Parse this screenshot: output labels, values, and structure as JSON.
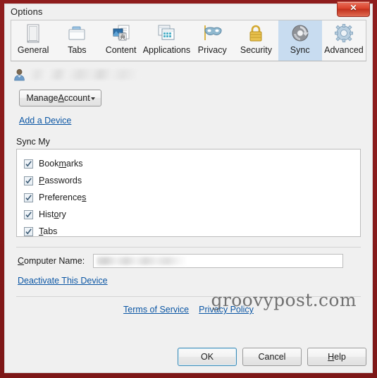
{
  "window": {
    "title": "Options",
    "close_glyph": "✕",
    "close_label": "Close",
    "frame_color": "#8a1b1b"
  },
  "tabs": [
    {
      "label": "General",
      "icon": "general-icon",
      "selected": false
    },
    {
      "label": "Tabs",
      "icon": "tabs-icon",
      "selected": false
    },
    {
      "label": "Content",
      "icon": "content-icon",
      "selected": false
    },
    {
      "label": "Applications",
      "icon": "applications-icon",
      "selected": false
    },
    {
      "label": "Privacy",
      "icon": "privacy-mask-icon",
      "selected": false
    },
    {
      "label": "Security",
      "icon": "security-lock-icon",
      "selected": false
    },
    {
      "label": "Sync",
      "icon": "sync-icon",
      "selected": true
    },
    {
      "label": "Advanced",
      "icon": "advanced-gear-icon",
      "selected": false
    }
  ],
  "sync_panel": {
    "account": {
      "avatar_icon": "user-avatar-icon",
      "name_value": "",
      "name_redacted": true
    },
    "manage_account": {
      "label_before": "Manage ",
      "label_accel": "A",
      "label_after": "ccount",
      "full_label": "Manage Account",
      "has_dropdown": true
    },
    "add_device_link": "Add a Device",
    "sync_my_label": "Sync My",
    "sync_items": [
      {
        "label_before": "Book",
        "accel": "m",
        "label_after": "arks",
        "full_label": "Bookmarks",
        "checked": true
      },
      {
        "label_before": "",
        "accel": "P",
        "label_after": "asswords",
        "full_label": "Passwords",
        "checked": true
      },
      {
        "label_before": "Preference",
        "accel": "s",
        "label_after": "",
        "full_label": "Preferences",
        "checked": true
      },
      {
        "label_before": "Hist",
        "accel": "o",
        "label_after": "ry",
        "full_label": "History",
        "checked": true
      },
      {
        "label_before": "",
        "accel": "T",
        "label_after": "abs",
        "full_label": "Tabs",
        "checked": true
      }
    ],
    "computer_name": {
      "label_accel": "C",
      "label_after": "omputer Name:",
      "full_label": "Computer Name:",
      "value": "",
      "value_redacted": true,
      "placeholder": ""
    },
    "deactivate_link": "Deactivate This Device",
    "terms_link": "Terms of Service",
    "privacy_link": "Privacy Policy"
  },
  "watermark": "groovypost.com",
  "buttons": {
    "ok": "OK",
    "cancel": "Cancel",
    "help_accel": "H",
    "help_after": "elp",
    "help_full": "Help"
  },
  "colors": {
    "selected_tab_bg": "#c8dcf0",
    "link": "#0b56a4",
    "default_button_border": "#3c8ab5"
  }
}
